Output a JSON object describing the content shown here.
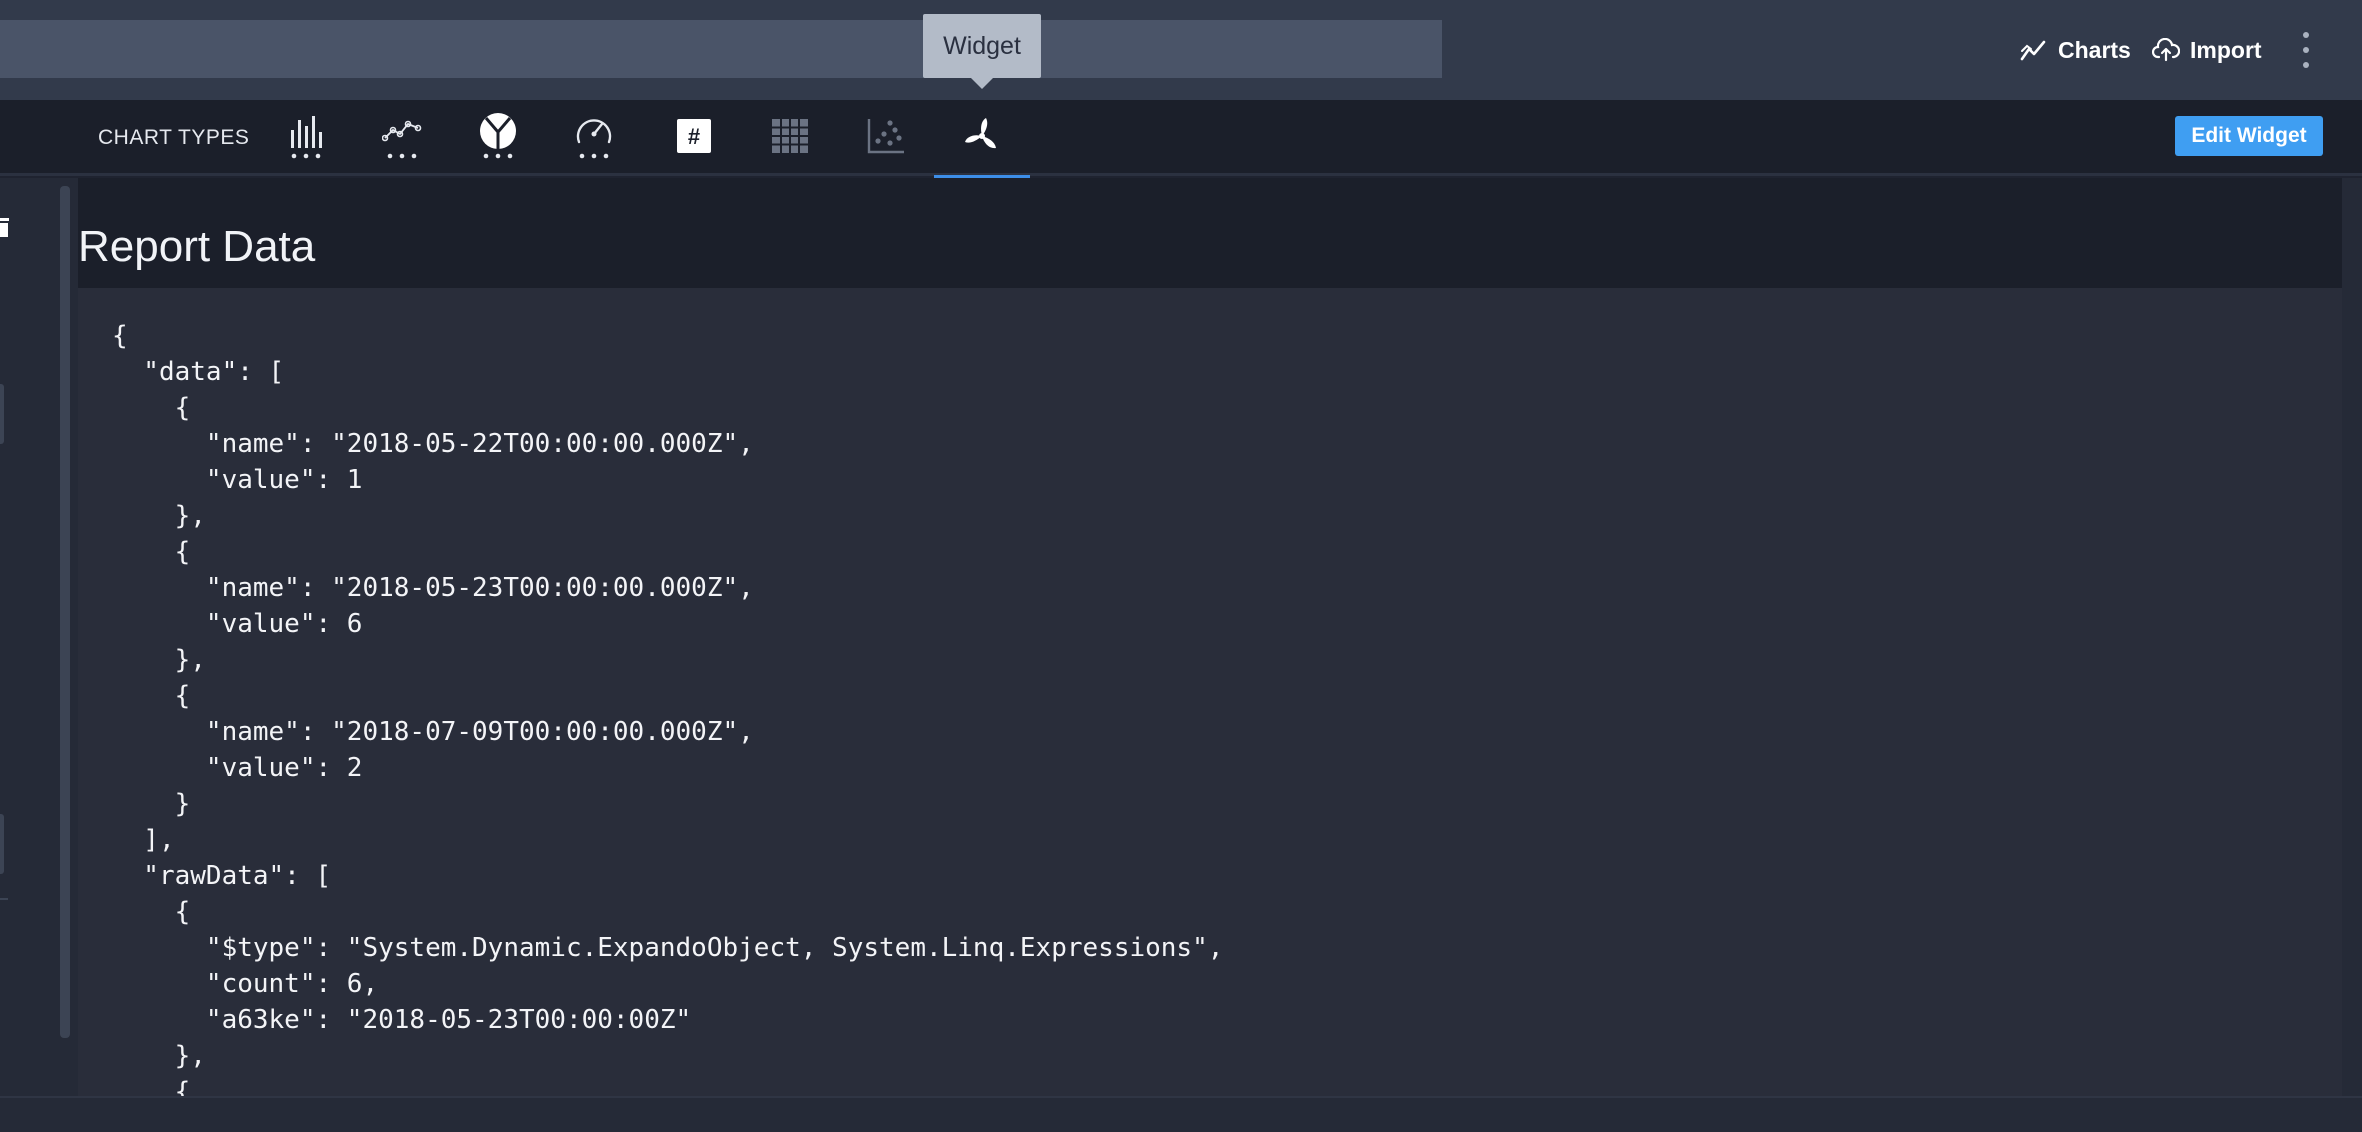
{
  "header": {
    "title_value": "",
    "tooltip": "Widget",
    "charts_label": "Charts",
    "import_label": "Import",
    "charts_icon": "line-chart-icon",
    "import_icon": "cloud-upload-icon",
    "menu_icon": "more-vertical-icon"
  },
  "chart_types": {
    "label": "CHART TYPES",
    "active": "pie",
    "items": [
      {
        "id": "bar",
        "icon": "bar-chart-icon"
      },
      {
        "id": "line",
        "icon": "line-chart-icon"
      },
      {
        "id": "pie",
        "icon": "pie-chart-icon"
      },
      {
        "id": "gauge",
        "icon": "gauge-icon"
      },
      {
        "id": "number",
        "icon": "hash-icon"
      },
      {
        "id": "table",
        "icon": "grid-table-icon"
      },
      {
        "id": "scatter",
        "icon": "scatter-icon"
      },
      {
        "id": "widget",
        "icon": "fan-icon"
      }
    ]
  },
  "edit_widget_label": "Edit Widget",
  "report": {
    "title": "Report Data",
    "json_text": "{\n  \"data\": [\n    {\n      \"name\": \"2018-05-22T00:00:00.000Z\",\n      \"value\": 1\n    },\n    {\n      \"name\": \"2018-05-23T00:00:00.000Z\",\n      \"value\": 6\n    },\n    {\n      \"name\": \"2018-07-09T00:00:00.000Z\",\n      \"value\": 2\n    }\n  ],\n  \"rawData\": [\n    {\n      \"$type\": \"System.Dynamic.ExpandoObject, System.Linq.Expressions\",\n      \"count\": 6,\n      \"a63ke\": \"2018-05-23T00:00:00Z\"\n    },\n    {"
  },
  "colors": {
    "accent": "#3f9ef2",
    "active_underline": "#3d8ee8",
    "topbar": "#323a4b",
    "panel": "#292d3a"
  }
}
